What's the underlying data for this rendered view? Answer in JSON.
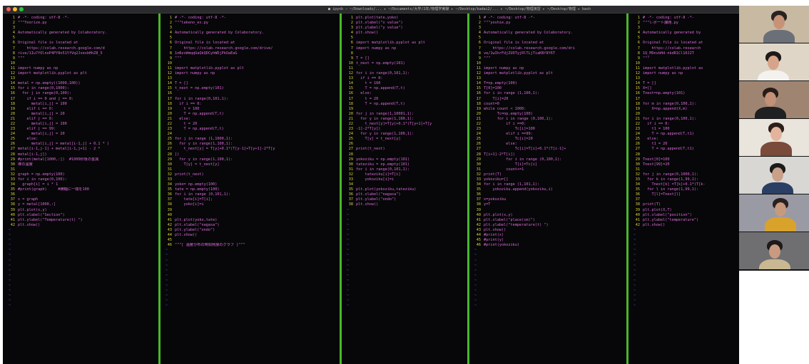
{
  "window": {
    "title_bar_text": "■ ipynb — ~/Downloads/... ▸ ~/Documents/大学/2年/物理学実験 ▸ ~/Desktop/kadai2/... ▸ ~/Desktop/物理演習 ▸ ~/Desktop/物理 ▸ bash",
    "traffic_lights": [
      "#ff5f57",
      "#febc2e",
      "#28c840"
    ]
  },
  "colors": {
    "background": "#070709",
    "code_text": "#d96ad8",
    "line_numbers": "#d7d23a",
    "pane_separator": "#47b829",
    "empty_line_tilde": "#3f52d8"
  },
  "panes": [
    {
      "lines": [
        "# -*- coding: utf-8 -*-",
        "\"\"\"Yoorize.py",
        "",
        "Automatically generated by Colaboratory.",
        "",
        "Original file is located at",
        "    https://colab.research.google.com/d",
        "rive/1Iu7fOlnoP4PY8n51YfVq2JxexbHhZ8_5",
        "\"\"\"",
        "",
        "import numpy as np",
        "import matplotlib.pyplot as plt",
        "",
        "metal = np.empty((1000,100))",
        "for i in range(0,1000):",
        "  for j in range(0,100):",
        "    if i == 0 and j == 0:",
        "      metal[i,j] = 100",
        "    elif i == 0:",
        "      metal[i,j] = 20",
        "    elif j == 0:",
        "      metal[i,j] = 100",
        "    elif j == 99:",
        "      metal[i,j] = 20",
        "    else:",
        "      metal[i,j] = metal[i-1,j] + 0.1 * (",
        "metal[i-1,j-1] + metal[i-1,j+1] - 2 *",
        "metal[i-1,j])",
        "#print(metal[1000,:])  #1000秒後の金属",
        "棒の温度",
        "",
        "graph = np.empty(100)",
        "for i in range(0,100):",
        "  graph[i] = i * 1",
        "#print(graph)     #横軸に一端を100",
        "",
        "x = graph",
        "y = metal[1000,:]",
        "plt.plot(x,y)",
        "plt.xlabel(\"Section\")",
        "plt.ylabel(\"Temperature(t) \")",
        "plt.show()"
      ],
      "tildes": 16
    },
    {
      "lines": [
        "# -*- coding: utf-8 -*-",
        "\"\"\"takeno_ex.py",
        "",
        "Automatically generated by Colaboratory.",
        "",
        "Original file is located at",
        "    https://colab.research.google.com/drive/",
        "1nNzxWmqqUaQkQDCyhWDjPkOaEaG",
        "\"\"\"",
        "",
        "import matplotlib.pyplot as plt",
        "import numpy as np",
        "",
        "T = []",
        "t_next = np.empty(101)",
        "",
        "for i in range(0,101,1):",
        "  if i == 0:",
        "    t = 100",
        "    T = np.append(T,t)",
        "  else:",
        "    t = 20",
        "    T = np.append(T,t)",
        "",
        "for j in range (1,1000,1):",
        "  for y in range(1,100,1):",
        "    t_next[y] = T[y]+0.1*(T[y-1]+T[y+1]-2*T[y",
        "])",
        "  for y in range(1,100,1):",
        "    T[y] = t_next[y]",
        "",
        "print(t_next)",
        "",
        "yoko= np.empty(100)",
        "tate = np.empty(100)",
        "for i in range (0,101,1):",
        "    tate[i]=T[i];",
        "    yoko[i]=i",
        "",
        "",
        "plt.plot(yoko,tate)",
        "plt.xlabel(\"nagasa\")",
        "plt.ylabel(\"ondo\")",
        "plt.show()",
        "",
        "\"\"\"[ 温度分布の時間発展のグラフ ]\"\"\""
      ],
      "tildes": 12
    },
    {
      "lines": [
        "plt.plot(tate,yoko)",
        "plt.xlabel(\"x value\")",
        "plt.ylabel(\"y value\")",
        "plt.show()",
        "",
        "import matplotlib.pyplot as plt",
        "import numpy as np",
        "",
        "T = []",
        "t_next = np.empty(101)",
        "",
        "for i in range(0,101,1):",
        "  if i == 0:",
        "    t = 100",
        "    T = np.append(T,t)",
        "  else:",
        "    t = 20",
        "    T = np.append(T,t)",
        "",
        "for j in range(1,10001,1):",
        "  for y in range(1,100,1):",
        "    t_next[y]=T[y]+0.1*(T[y+1]+T[y",
        "-1]-2*T[y])",
        "  for y in range(1,100,1):",
        "    T[y] = t_next[y]",
        "",
        "print(t_next)",
        "",
        "yokoziku = np.empty(101)",
        "tateziku = np.empty(101)",
        "for i in range(0,101,1):",
        "    tateziku[i]=T[i]",
        "    yokoziku[i]=i",
        "",
        "plt.plot(yokoziku,tateziku)",
        "plt.xlabel(\"nagasa\")",
        "plt.ylabel(\"ondo\")",
        "plt.show()"
      ],
      "tildes": 20
    },
    {
      "lines": [
        "# -*- coding: utf-8 -*-",
        "\"\"\"yoshie.py",
        "",
        "Automatically generated by Colaboratory.",
        "",
        "Original file is located at",
        "    https://colab.research.google.com/dri",
        "ve/1wIhrFdjZUOTyjRlTLjTiaKBf8Y6T",
        "\"\"\"",
        "",
        "import numpy as np",
        "import matplotlib.pyplot as plt",
        "",
        "T=np.empty(100)",
        "T[0]=100",
        "for i in range (1,100,1):",
        "    T[i]=20",
        "count=0",
        "while count < 1000:",
        "      Tc=np.empty(100)",
        "      for i in range (0,100,1):",
        "          if i ==0:",
        "              Tc[i]=100",
        "          elif i ==99:",
        "              Tc[i]=20",
        "          else:",
        "              Tc[i]=T[i]+0.1*(T[i-1]+",
        "T[i+1]-2*T[i])",
        "          for i in range (0,100,1):",
        "              T[i]=Tc[i]",
        "          count+=1",
        "print(T)",
        "yokoziku=[]",
        "for i in range (1,101,1):",
        "    yokoziku.append(yokoziku,i)",
        "",
        "x=yokoziku",
        "y=T",
        "",
        "plt.plot(x,y)",
        "plt.xlabel(\"place(cm)\")",
        "plt.ylabel(\"temperature(t) \")",
        "plt.show()",
        "#print(x)",
        "#print(y)",
        "#print(yokoziku)"
      ],
      "tildes": 12
    },
    {
      "lines": [
        "# -*- coding: utf-8 -*-",
        "\"\"\"レポート課題.py",
        "",
        "Automatically generated by",
        "",
        "Original file is located at",
        "    https://colab.research",
        "1Q_MOnvbHd-nkdR1Cl10J2T",
        "\"\"\"",
        "",
        "import matplotlib.pyplot as",
        "import numpy as np",
        "",
        "T = []",
        "X=[]",
        "Tnext=np.empty(101)",
        "",
        "for m in range(0,100,1):",
        "    X=np.append(X,m)",
        "",
        "for i in range(0,100,1):",
        "  if i == 0:",
        "    t1 = 100",
        "    T = np.append(T,t1)",
        "  else:",
        "    t1 = 20",
        "    T = np.append(T,t1)",
        "",
        "Tnext[0]=100",
        "Tnext[99]=20",
        "",
        "for j in range(0,1000,1):",
        "  for k in range(1,99,1):",
        "    Tnext[k] =T[k]+0.1*(T[k-",
        "  for l in range(1,99,1):",
        "    T[l]=Tnext[l]",
        "",
        "print(T)",
        "plt.plot(X,T)",
        "plt.xlabel(\"position\")",
        "plt.ylabel(\"temperature\")",
        "plt.show()"
      ],
      "tildes": 16
    }
  ],
  "video_call": {
    "participants": [
      {
        "id": "p1",
        "bg": "#c7b9a2",
        "skin": "#c79377",
        "hair": "#2a2220",
        "shirt": "#6b6f78"
      },
      {
        "id": "p2",
        "bg": "#dfd6c7",
        "skin": "#d6a48a",
        "hair": "#1d1a19",
        "shirt": "#f4f2ee"
      },
      {
        "id": "p3",
        "bg": "#a08472",
        "skin": "#c49078",
        "hair": "#261c18",
        "shirt": "#1f2022"
      },
      {
        "id": "p4",
        "bg": "#e9e4dc",
        "skin": "#e2b49c",
        "hair": "#2c1f1a",
        "shirt": "#7a4a3a"
      },
      {
        "id": "p5",
        "bg": "#d8d7d4",
        "skin": "#c9a088",
        "hair": "#1b1a1a",
        "shirt": "#2b3e63"
      },
      {
        "id": "p6",
        "bg": "#9a9aa4",
        "skin": "#c79a7e",
        "hair": "#2a2020",
        "shirt": "#d9a22b"
      },
      {
        "id": "p7",
        "bg": "#6f6f72",
        "skin": "#c89a80",
        "hair": "#1d1a19",
        "shirt": "#c9b892"
      }
    ]
  }
}
